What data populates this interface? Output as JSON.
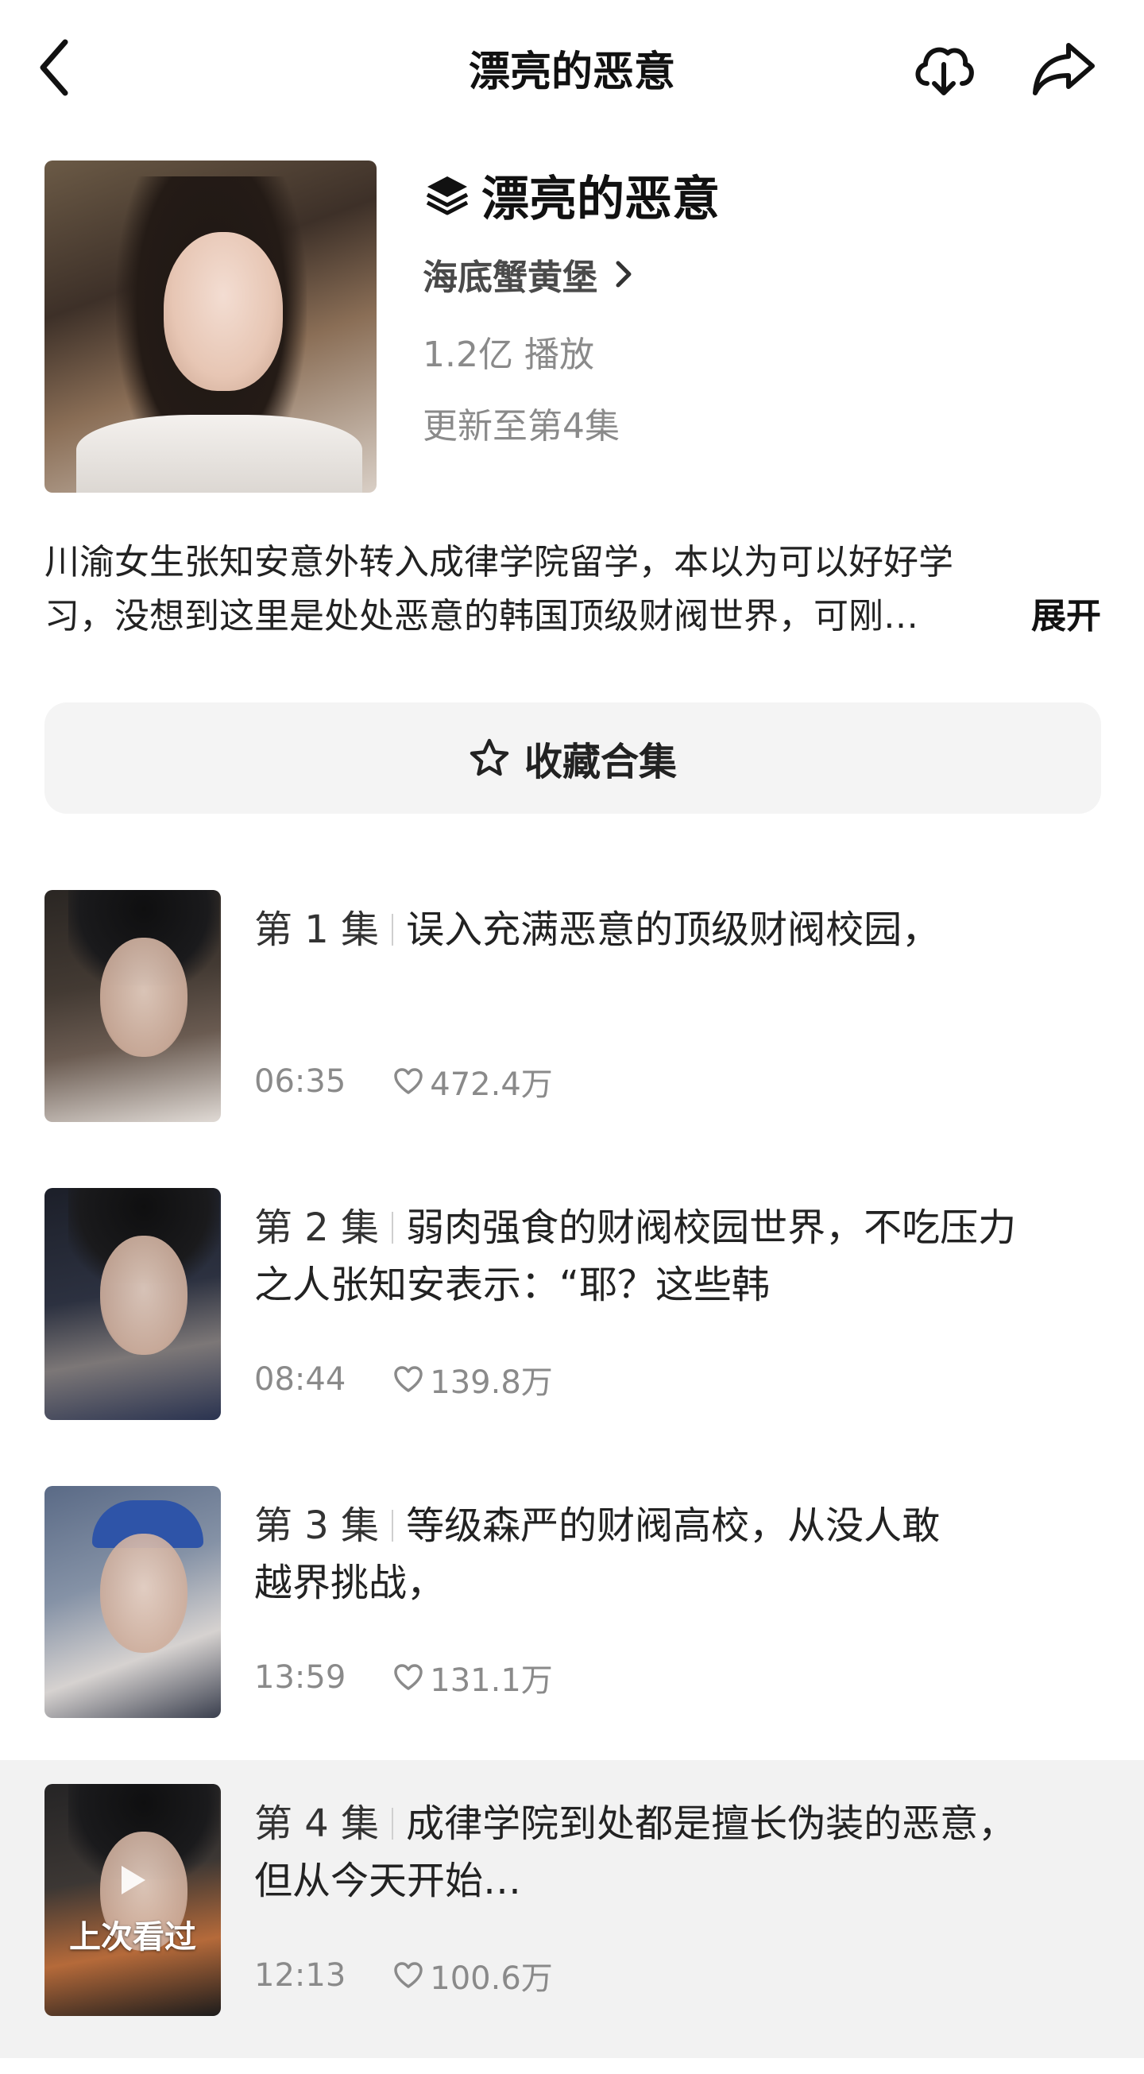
{
  "header": {
    "title": "漂亮的恶意",
    "back_icon": "chevron-left-icon",
    "download_icon": "download-icon",
    "share_icon": "share-icon"
  },
  "collection": {
    "title": "漂亮的恶意",
    "author": "海底蟹黄堡",
    "plays": "1.2亿 播放",
    "update_status": "更新至第4集",
    "description_lines": [
      "川渝女生张知安意外转入成律学院留学，本以为可以好好学",
      "习，没想到这里是处处恶意的韩国顶级财阀世界，可刚…"
    ],
    "expand_label": "展开",
    "favorite_label": "收藏合集"
  },
  "episodes": [
    {
      "number": "第 1 集",
      "title_lines": [
        "误入充满恶意的顶级财阀校园，"
      ],
      "duration": "06:35",
      "likes": "472.4万"
    },
    {
      "number": "第 2 集",
      "title_lines": [
        "弱肉强食的财阀校园世界，不吃压力",
        "之人张知安表示：“耶？这些韩"
      ],
      "duration": "08:44",
      "likes": "139.8万"
    },
    {
      "number": "第 3 集",
      "title_lines": [
        "等级森严的财阀高校，从没人敢",
        "越界挑战，"
      ],
      "duration": "13:59",
      "likes": "131.1万"
    },
    {
      "number": "第 4 集",
      "title_lines": [
        "成律学院到处都是擅长伪装的恶意，",
        "但从今天开始…"
      ],
      "duration": "12:13",
      "likes": "100.6万",
      "last_watched_label": "上次看过",
      "active": true
    }
  ]
}
